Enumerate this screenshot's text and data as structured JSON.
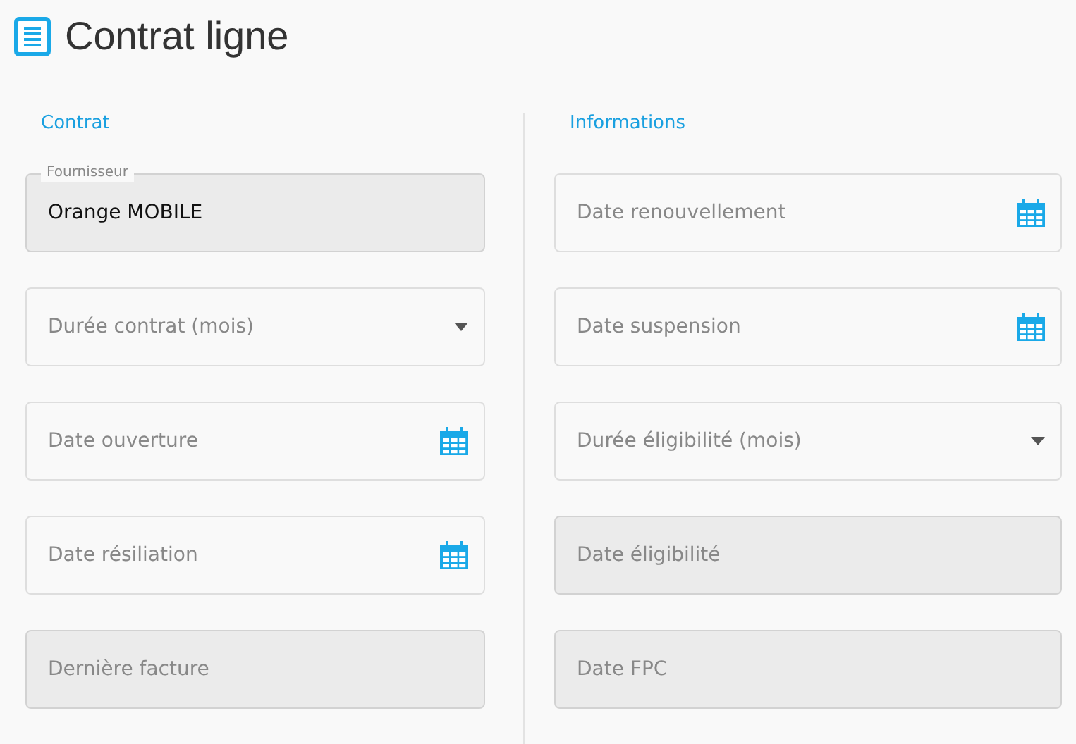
{
  "title": "Contrat ligne",
  "columns": [
    {
      "heading": "Contrat",
      "fields": [
        {
          "kind": "text",
          "label": "Fournisseur",
          "value": "Orange MOBILE",
          "disabled": true
        },
        {
          "kind": "select",
          "placeholder": "Durée contrat (mois)",
          "disabled": false
        },
        {
          "kind": "date",
          "placeholder": "Date ouverture",
          "disabled": false
        },
        {
          "kind": "date",
          "placeholder": "Date résiliation",
          "disabled": false
        },
        {
          "kind": "text",
          "placeholder": "Dernière facture",
          "disabled": true
        }
      ]
    },
    {
      "heading": "Informations",
      "fields": [
        {
          "kind": "date",
          "placeholder": "Date renouvellement",
          "disabled": false
        },
        {
          "kind": "date",
          "placeholder": "Date suspension",
          "disabled": false
        },
        {
          "kind": "select",
          "placeholder": "Durée éligibilité (mois)",
          "disabled": false
        },
        {
          "kind": "text",
          "placeholder": "Date éligibilité",
          "disabled": true
        },
        {
          "kind": "text",
          "placeholder": "Date FPC",
          "disabled": true
        }
      ]
    }
  ]
}
